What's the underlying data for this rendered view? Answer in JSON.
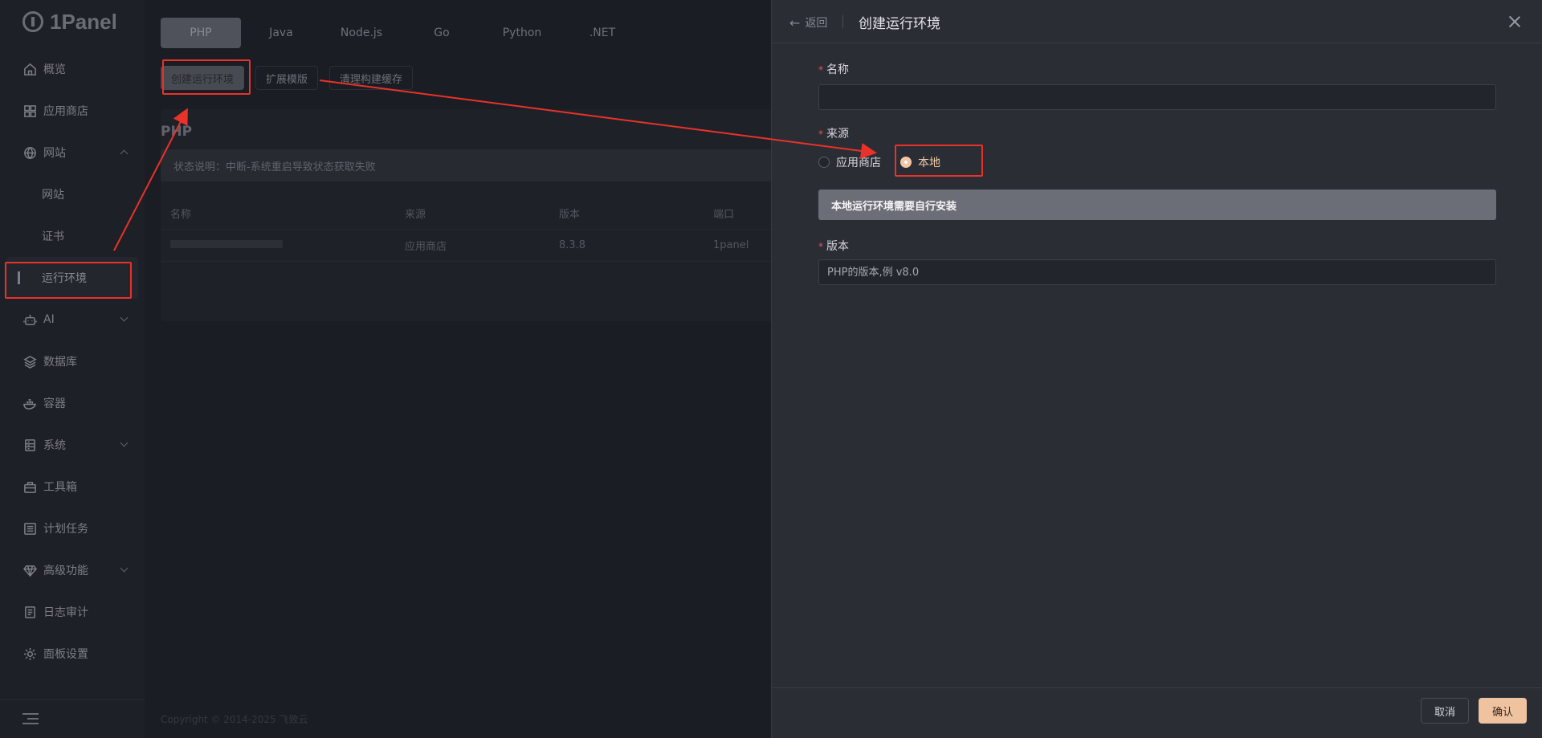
{
  "app": {
    "logo_text": "1Panel"
  },
  "sidebar": {
    "items": [
      {
        "label": "概览",
        "icon": "home-icon"
      },
      {
        "label": "应用商店",
        "icon": "grid-icon"
      },
      {
        "label": "网站",
        "icon": "globe-icon",
        "expanded": true,
        "children": [
          {
            "label": "网站"
          },
          {
            "label": "证书"
          },
          {
            "label": "运行环境",
            "active": true
          }
        ]
      },
      {
        "label": "AI",
        "icon": "robot-icon"
      },
      {
        "label": "数据库",
        "icon": "layers-icon"
      },
      {
        "label": "容器",
        "icon": "whale-icon"
      },
      {
        "label": "系统",
        "icon": "server-icon"
      },
      {
        "label": "工具箱",
        "icon": "toolbox-icon"
      },
      {
        "label": "计划任务",
        "icon": "list-icon"
      },
      {
        "label": "高级功能",
        "icon": "diamond-icon"
      },
      {
        "label": "日志审计",
        "icon": "log-icon"
      },
      {
        "label": "面板设置",
        "icon": "gear-icon"
      }
    ]
  },
  "main": {
    "lang_tabs": [
      "PHP",
      "Java",
      "Node.js",
      "Go",
      "Python",
      ".NET"
    ],
    "active_tab": "PHP",
    "actions": {
      "create": "创建运行环境",
      "ext": "扩展模版",
      "clean": "清理构建缓存"
    },
    "card_title": "PHP",
    "status_note": "状态说明：中断-系统重启导致状态获取失败",
    "table": {
      "headers": [
        "名称",
        "来源",
        "版本",
        "端口"
      ],
      "rows": [
        {
          "name": "",
          "source": "应用商店",
          "version": "8.3.8",
          "port": "1panel"
        }
      ]
    },
    "copyright": "Copyright © 2014-2025 飞致云"
  },
  "drawer": {
    "back_label": "返回",
    "title": "创建运行环境",
    "fields": {
      "name_label": "名称",
      "name_value": "",
      "source_label": "来源",
      "source_options": [
        "应用商店",
        "本地"
      ],
      "source_selected": "本地",
      "notice": "本地运行环境需要自行安装",
      "version_label": "版本",
      "version_placeholder": "PHP的版本,例 v8.0"
    },
    "cancel_label": "取消",
    "confirm_label": "确认"
  },
  "colors": {
    "accent": "#f0c3a0",
    "annotation": "#e8322a",
    "required": "#e8505b"
  }
}
